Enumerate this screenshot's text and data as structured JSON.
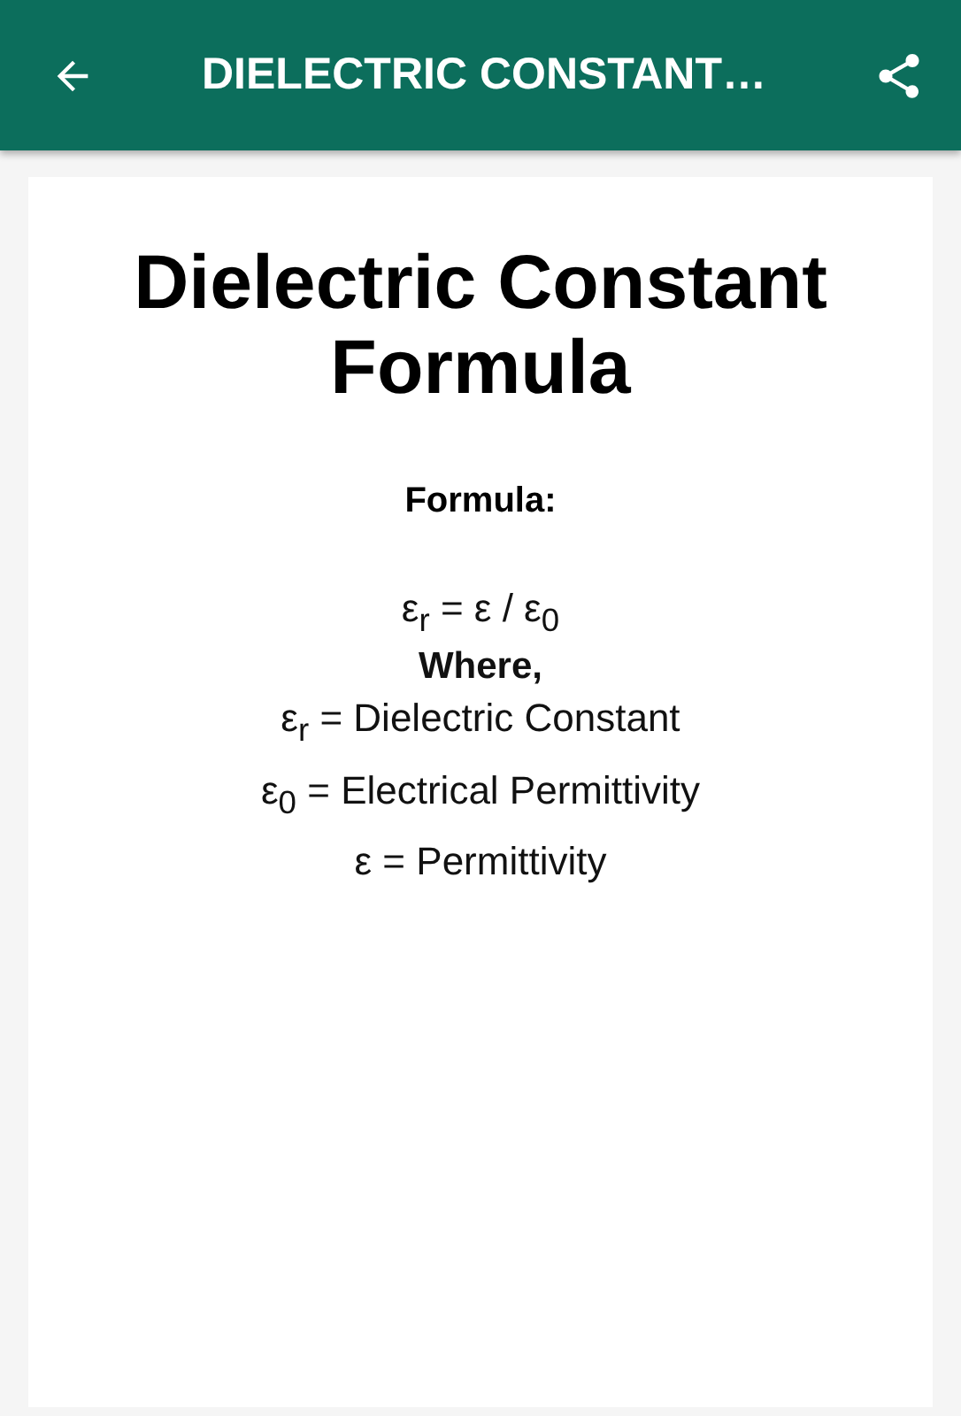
{
  "app_bar": {
    "title": "DIELECTRIC CONSTANT…"
  },
  "card": {
    "heading": "Dielectric Constant Formula",
    "label": "Formula:",
    "lines": [
      {
        "text": "ε$_{r}$ = ε / ε$_{0}$",
        "kind": "formula"
      },
      {
        "text": "Where,",
        "kind": "bold"
      },
      {
        "text": "ε$_{r}$ = Dielectric Constant",
        "kind": "plain"
      },
      {
        "text": "ε$_{0}$ = Electrical Permittivity",
        "kind": "plain"
      },
      {
        "text": "ε = Permittivity",
        "kind": "plain"
      }
    ]
  }
}
